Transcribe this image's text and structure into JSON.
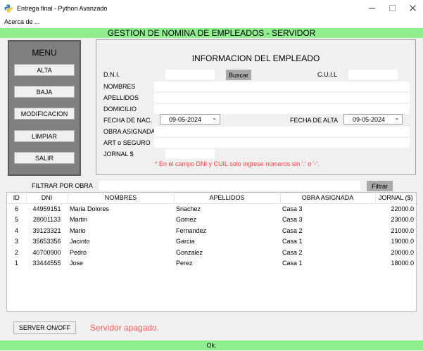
{
  "window": {
    "title": "Entrega final - Python Avanzado"
  },
  "menubar": {
    "about": "Acerca de ..."
  },
  "header": {
    "title": "GESTION DE NOMINA DE EMPLEADOS - SERVIDOR"
  },
  "menu": {
    "title": "MENU",
    "buttons": [
      "ALTA",
      "BAJA",
      "MODIFICACION",
      "LIMPIAR",
      "SALIR"
    ]
  },
  "info": {
    "title": "INFORMACION DEL EMPLEADO",
    "labels": {
      "dni": "D.N.I.",
      "cuil": "C.U.I.L",
      "nombres": "NOMBRES",
      "apellidos": "APELLIDOS",
      "domicilio": "DOMICILIO",
      "fecha_nac": "FECHA DE NAC.",
      "fecha_alta": "FECHA DE ALTA",
      "obra": "OBRA ASIGNADA",
      "art": "ART o SEGURO",
      "jornal": "JORNAL $"
    },
    "buscar": "Buscar",
    "fecha_nac_value": "09-05-2024",
    "fecha_alta_value": "09-05-2024",
    "warning": "* En el campo DNI y CUIL solo ingrese números sin '.' o '-'."
  },
  "filter": {
    "label": "FILTRAR POR OBRA",
    "button": "Filtrar",
    "value": ""
  },
  "table": {
    "columns": [
      "ID",
      "DNI",
      "NOMBRES",
      "APELLIDOS",
      "OBRA ASIGNADA",
      "JORNAL ($)"
    ],
    "rows": [
      [
        "6",
        "44959151",
        "Maria Dolores",
        "Snachez",
        "Casa 3",
        "22000.0"
      ],
      [
        "5",
        "28001133",
        "Martin",
        "Gomez",
        "Casa 3",
        "23000.0"
      ],
      [
        "4",
        "39123321",
        "Mario",
        "Fernandez",
        "Casa 2",
        "21000.0"
      ],
      [
        "3",
        "35653356",
        "Jacinto",
        "Garcia",
        "Casa 1",
        "19000.0"
      ],
      [
        "2",
        "40700900",
        "Pedro",
        "Gonzalez",
        "Casa 2",
        "20000.0"
      ],
      [
        "1",
        "33444555",
        "Jose",
        "Perez",
        "Casa 1",
        "18000.0"
      ]
    ]
  },
  "server": {
    "button": "SERVER ON/OFF",
    "status": "Servidor apagado."
  },
  "status_bar": {
    "text": "Ok."
  },
  "colors": {
    "accent_green": "#90ee90",
    "status_red": "#ff5a5a",
    "menu_gray": "#808080"
  }
}
